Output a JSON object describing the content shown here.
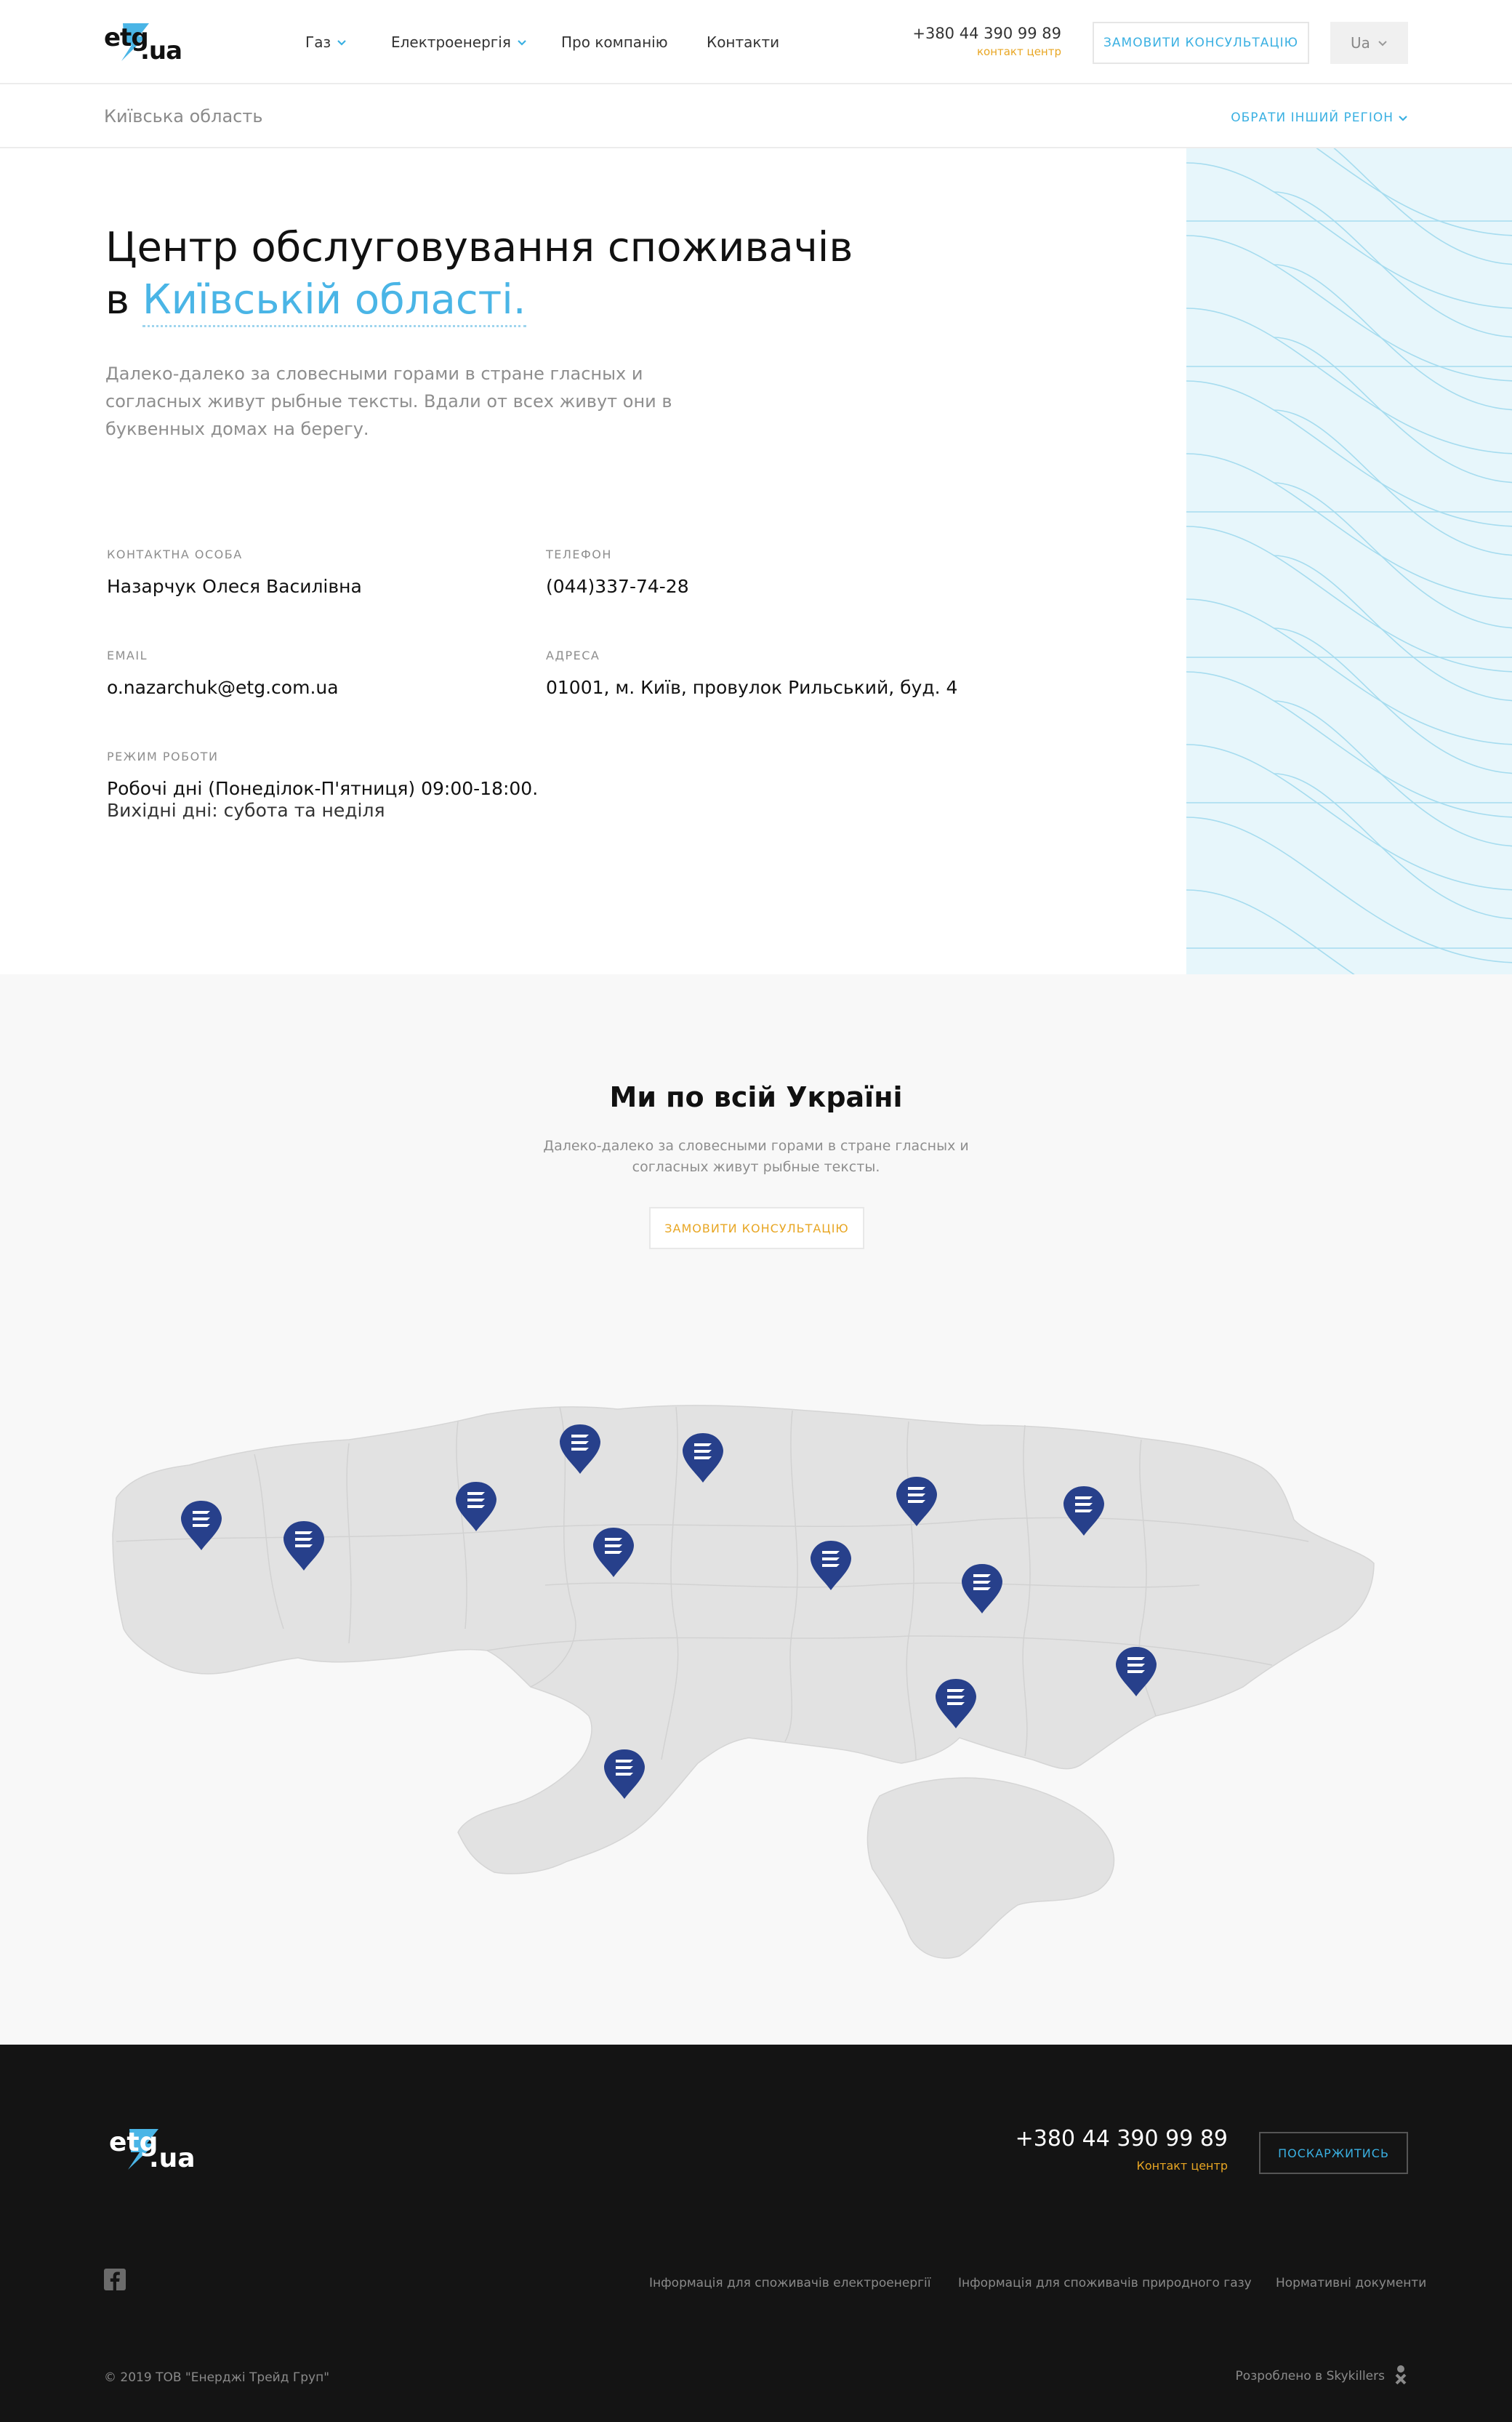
{
  "header": {
    "logo": {
      "part1": "etg",
      "part2": ".ua"
    },
    "nav": [
      {
        "label": "Газ",
        "has_dropdown": true
      },
      {
        "label": "Електроенергія",
        "has_dropdown": true
      },
      {
        "label": "Про компанію",
        "has_dropdown": false
      },
      {
        "label": "Контакти",
        "has_dropdown": false
      }
    ],
    "phone": "+380 44 390 99 89",
    "phone_sub": "контакт центр",
    "consult_button": "Замовити консультацію",
    "lang": "Ua"
  },
  "region_bar": {
    "current": "Київська область",
    "change_label": "Обрати інший регіон"
  },
  "hero": {
    "title_line1": "Центр обслуговування споживачів",
    "title_prefix": "в",
    "title_highlight": "Київській області.",
    "description": "Далеко-далеко за словесными горами в стране гласных и согласных живут рыбные тексты. Вдали от всех живут они в буквенных домах на берегу."
  },
  "contacts": {
    "person": {
      "label": "Контактна особа",
      "value": "Назарчук Олеся Василівна"
    },
    "phone": {
      "label": "Телефон",
      "value": "(044)337-74-28"
    },
    "email": {
      "label": "Email",
      "value": "o.nazarchuk@etg.com.ua"
    },
    "address": {
      "label": "Адреса",
      "value": "01001, м. Київ, провулок Рильський, буд. 4"
    },
    "schedule": {
      "label": "Режим роботи",
      "line1": "Робочі дні (Понеділок-П'ятниця) 09:00-18:00.",
      "line2": "Вихідні дні: субота та неділя"
    }
  },
  "map_section": {
    "title": "Ми по всій Україні",
    "description": "Далеко-далеко за словесными горами в стране гласных и согласных живут рыбные тексты.",
    "consult_button": "Замовити консультацію",
    "map_colors": {
      "land": "#e2e2e2",
      "border": "#d0d0d0",
      "pin": "#27408b"
    }
  },
  "footer": {
    "logo": {
      "part1": "etg",
      "part2": ".ua"
    },
    "phone": "+380 44 390 99 89",
    "phone_sub": "Контакт центр",
    "complain_button": "Поскаржитись",
    "links": [
      "Інформація для споживачів електроенергії",
      "Інформація для споживачів природного газу",
      "Нормативні документи"
    ],
    "copyright": "© 2019 ТОВ \"Енерджі Трейд Груп\"",
    "developer": "Розроблено в Skykillers"
  },
  "colors": {
    "accent_blue": "#3ab0e2",
    "accent_orange": "#e8a623",
    "footer_bg": "#141414",
    "pattern_bg": "#e7f6fb"
  }
}
